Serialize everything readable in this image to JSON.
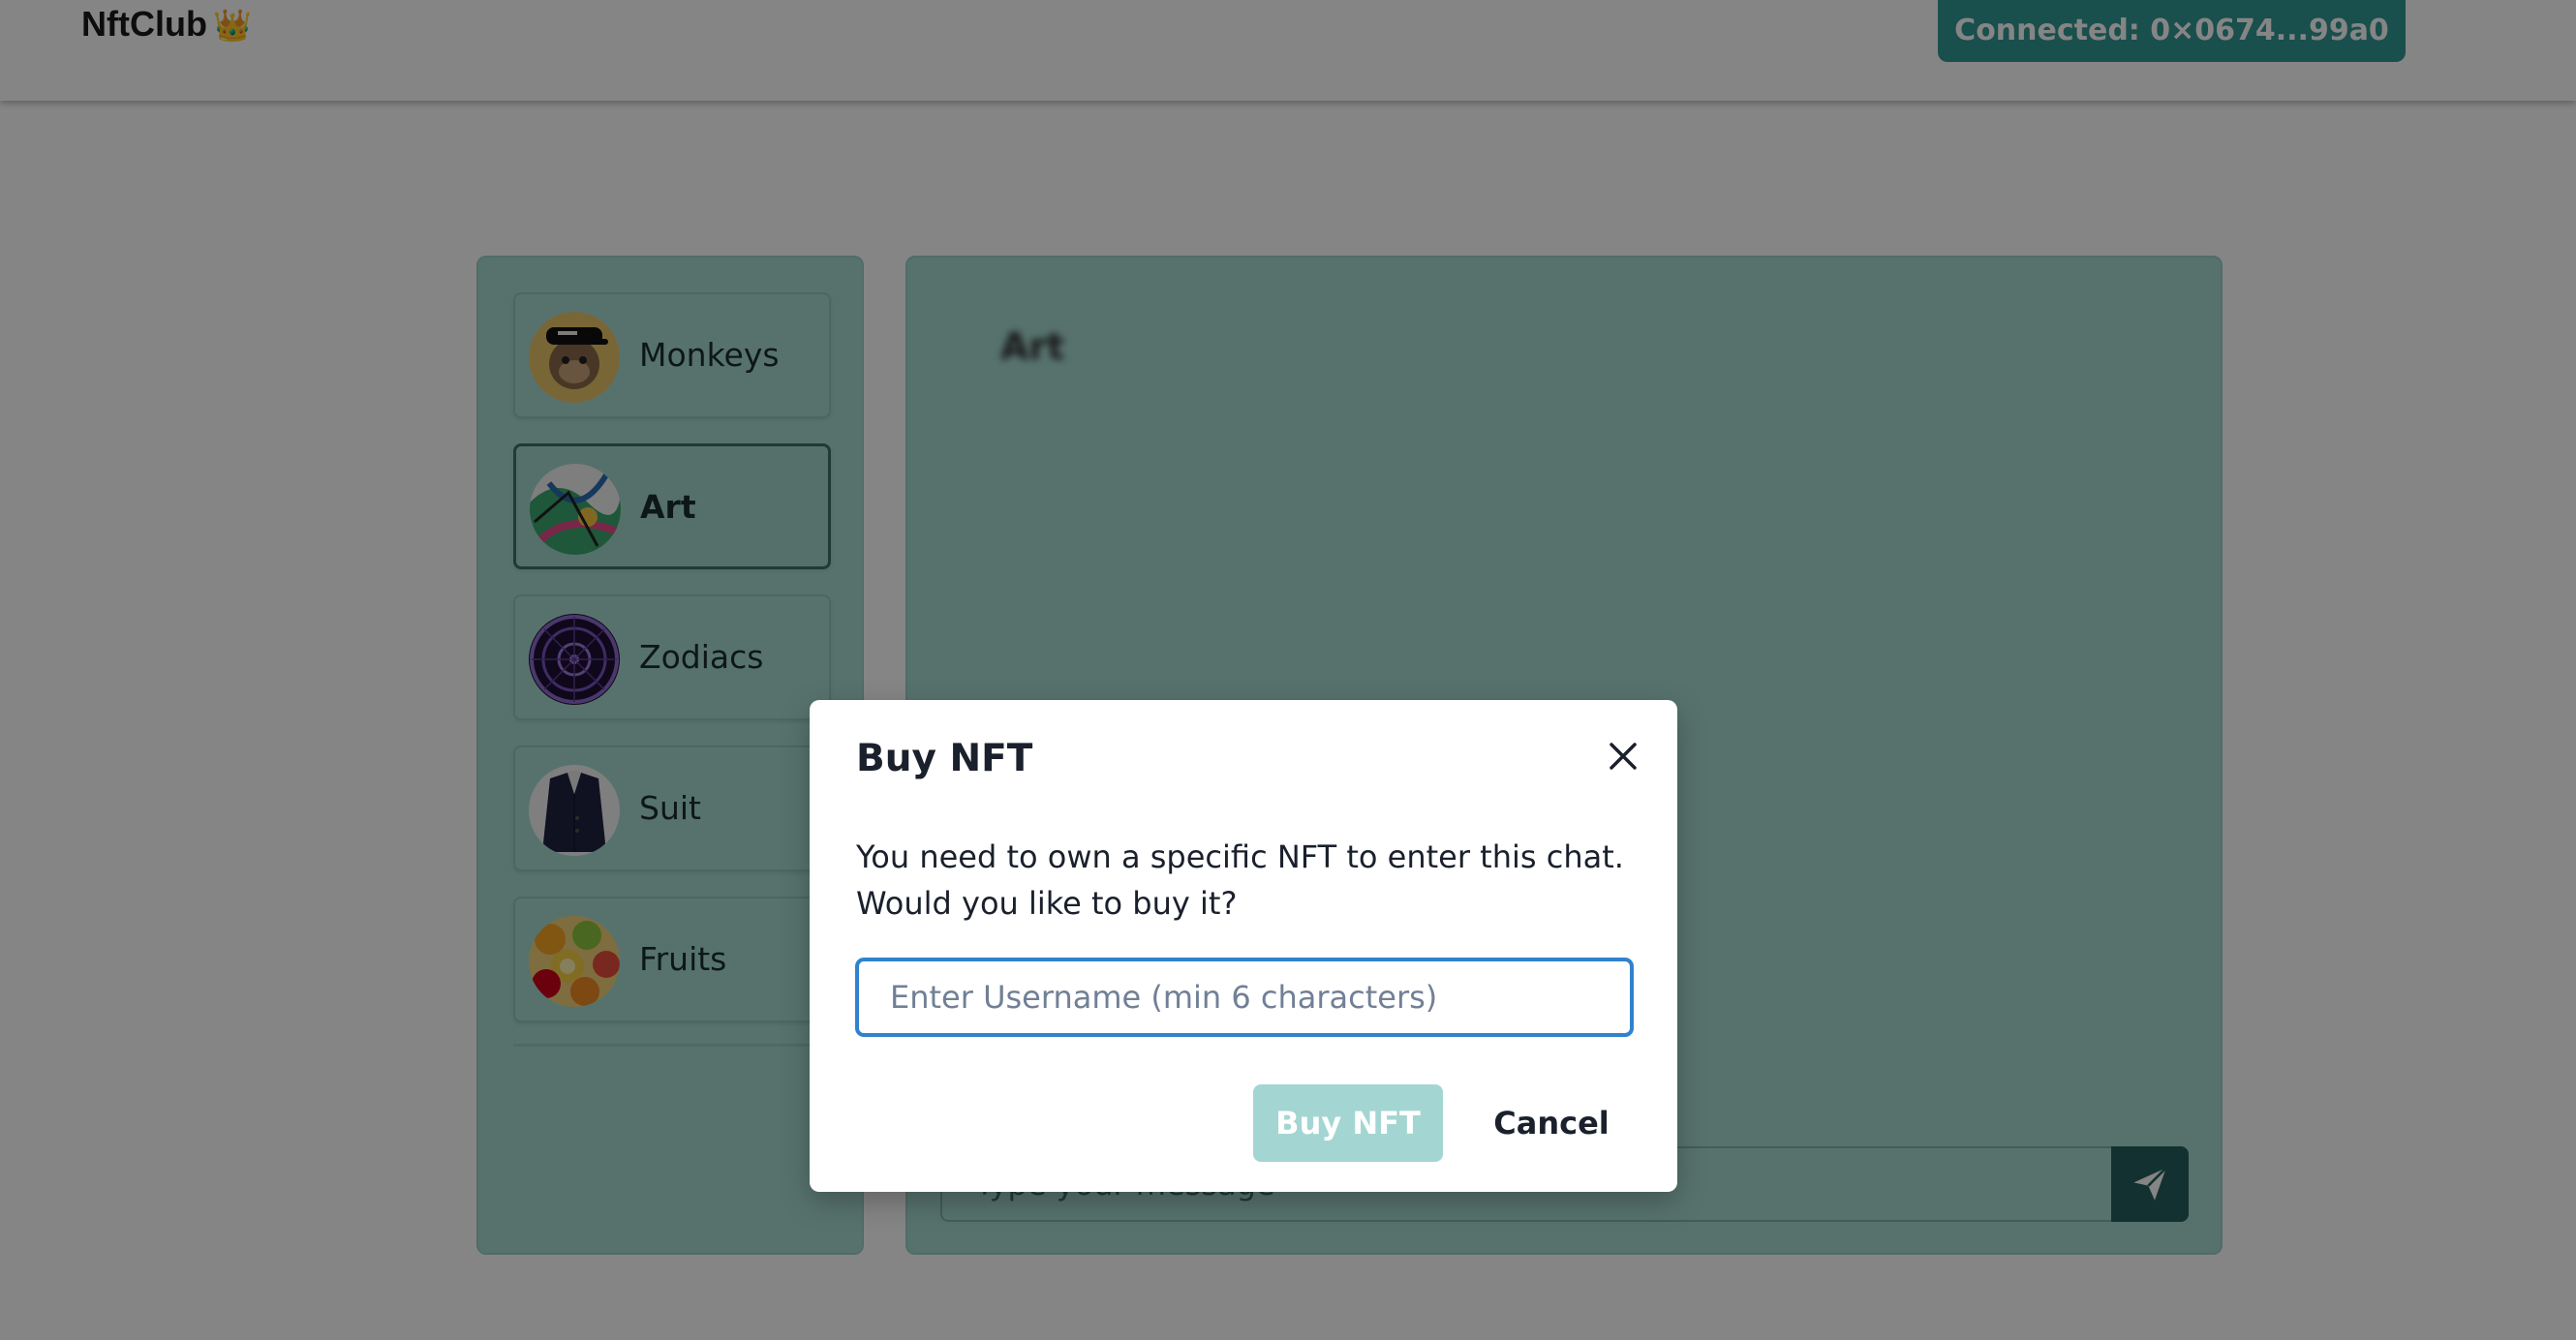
{
  "header": {
    "brand": "NftClub",
    "brand_icon": "crown-icon",
    "brand_glyph": "👑",
    "wallet_button": "Connected: 0×0674...99a0"
  },
  "sidebar": {
    "channels": [
      {
        "label": "Monkeys",
        "icon": "ape-avatar",
        "active": false
      },
      {
        "label": "Art",
        "icon": "art-avatar",
        "active": true
      },
      {
        "label": "Zodiacs",
        "icon": "zodiac-avatar",
        "active": false
      },
      {
        "label": "Suit",
        "icon": "suit-avatar",
        "active": false
      },
      {
        "label": "Fruits",
        "icon": "fruits-avatar",
        "active": false
      }
    ]
  },
  "chat": {
    "title": "Art",
    "message_placeholder": "Type your message",
    "send_icon": "send-icon"
  },
  "modal": {
    "title": "Buy NFT",
    "body": "You need to own a specific NFT to enter this chat. Would you like to buy it?",
    "username_value": "",
    "username_placeholder": "Enter Username (min 6 characters)",
    "buy_label": "Buy NFT",
    "cancel_label": "Cancel",
    "close_icon": "close-icon"
  },
  "colors": {
    "accent": "#319795",
    "panel": "#a8dbd1",
    "send_button": "#285e61",
    "focus_border": "#3182ce",
    "buy_disabled": "#a3d6d2"
  }
}
